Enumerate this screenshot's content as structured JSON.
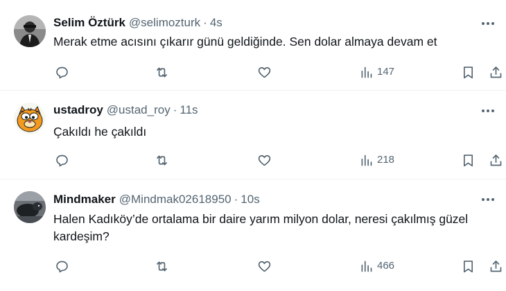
{
  "tweets": [
    {
      "name": "Selim Öztürk",
      "handle": "@selimozturk",
      "separator": "·",
      "time": "4s",
      "text": "Merak etme acısını çıkarır günü geldiğinde. Sen dolar almaya devam et",
      "views": "147",
      "avatar": "portrait-photo"
    },
    {
      "name": "ustadroy",
      "handle": "@ustad_roy",
      "separator": "·",
      "time": "11s",
      "text": "Çakıldı he çakıldı",
      "views": "218",
      "avatar": "garfield-cartoon"
    },
    {
      "name": "Mindmaker",
      "handle": "@Mindmak02618950",
      "separator": "·",
      "time": "10s",
      "text": "Halen Kadıköy’de ortalama bir daire yarım milyon dolar, neresi çakılmış güzel kardeşim?",
      "views": "466",
      "avatar": "dark-photo"
    }
  ],
  "icons": {
    "reply": "reply-icon",
    "retweet": "retweet-icon",
    "like": "heart-icon",
    "views": "views-chart-icon",
    "bookmark": "bookmark-icon",
    "share": "share-icon",
    "more": "more-icon"
  },
  "colors": {
    "text": "#0f1419",
    "secondary": "#536471",
    "divider": "#eff3f4"
  }
}
